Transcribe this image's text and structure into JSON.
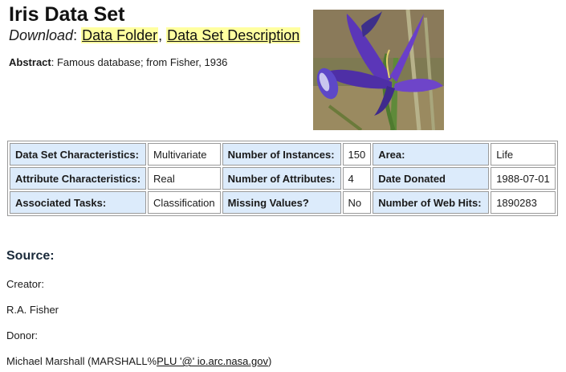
{
  "title": "Iris Data Set",
  "download": {
    "label": "Download",
    "sep": ":",
    "comma": ",",
    "links": [
      "Data Folder",
      "Data Set Description"
    ]
  },
  "abstract": {
    "label": "Abstract",
    "text": ": Famous database; from Fisher, 1936"
  },
  "image": {
    "subject": "purple iris flower photo",
    "accent": "#6a3fc0"
  },
  "table": {
    "rows": [
      [
        [
          "Data Set Characteristics:",
          "Multivariate"
        ],
        [
          "Number of Instances:",
          "150"
        ],
        [
          "Area:",
          "Life"
        ]
      ],
      [
        [
          "Attribute Characteristics:",
          "Real"
        ],
        [
          "Number of Attributes:",
          "4"
        ],
        [
          "Date Donated",
          "1988-07-01"
        ]
      ],
      [
        [
          "Associated Tasks:",
          "Classification"
        ],
        [
          "Missing Values?",
          "No"
        ],
        [
          "Number of Web Hits:",
          "1890283"
        ]
      ]
    ]
  },
  "source": {
    "heading": "Source:",
    "creator_label": "Creator:",
    "creator": "R.A. Fisher",
    "donor_label": "Donor:",
    "donor_name": "Michael Marshall (MARSHALL%",
    "donor_link": "PLU '@' io.arc.nasa.gov",
    "donor_end": ")"
  },
  "colors": {
    "key_cell": "#dcebfb",
    "link_highlight": "#ffffa0"
  }
}
